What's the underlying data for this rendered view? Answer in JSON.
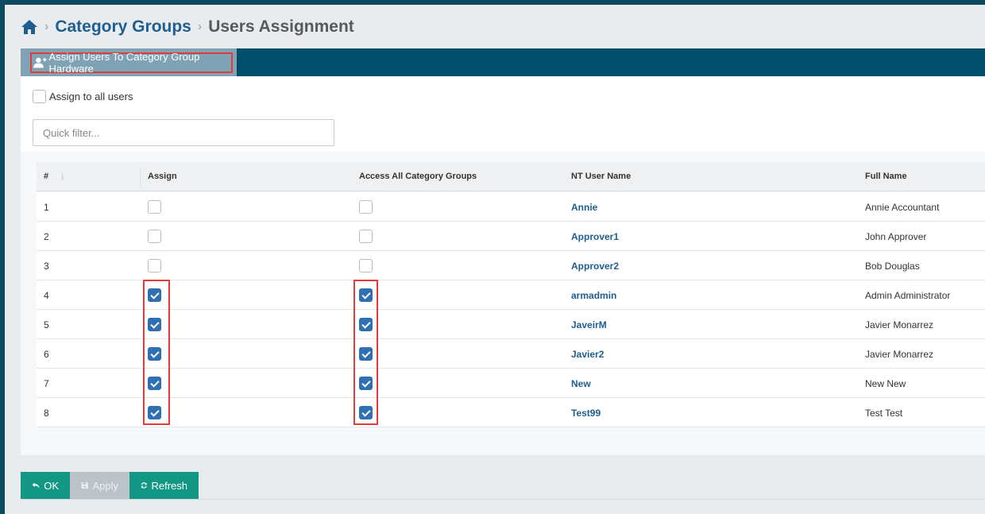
{
  "breadcrumb": {
    "home_icon": "home-icon",
    "parent": "Category Groups",
    "current": "Users Assignment"
  },
  "tab": {
    "label": "Assign Users To Category Group Hardware",
    "icon": "user-plus-icon"
  },
  "assign_all": {
    "label": "Assign to all users",
    "checked": false
  },
  "filter": {
    "placeholder": "Quick filter...",
    "value": ""
  },
  "grid": {
    "columns": [
      "#",
      "Assign",
      "Access All Category Groups",
      "NT User Name",
      "Full Name"
    ],
    "rows": [
      {
        "num": "1",
        "assign": false,
        "access_all": false,
        "user": "Annie",
        "full_name": "Annie Accountant"
      },
      {
        "num": "2",
        "assign": false,
        "access_all": false,
        "user": "Approver1",
        "full_name": "John Approver"
      },
      {
        "num": "3",
        "assign": false,
        "access_all": false,
        "user": "Approver2",
        "full_name": "Bob Douglas"
      },
      {
        "num": "4",
        "assign": true,
        "access_all": true,
        "user": "armadmin",
        "full_name": "Admin Administrator"
      },
      {
        "num": "5",
        "assign": true,
        "access_all": true,
        "user": "JaveirM",
        "full_name": "Javier Monarrez"
      },
      {
        "num": "6",
        "assign": true,
        "access_all": true,
        "user": "Javier2",
        "full_name": "Javier Monarrez"
      },
      {
        "num": "7",
        "assign": true,
        "access_all": true,
        "user": "New",
        "full_name": "New New"
      },
      {
        "num": "8",
        "assign": true,
        "access_all": true,
        "user": "Test99",
        "full_name": "Test Test"
      }
    ]
  },
  "footer": {
    "ok_label": "OK",
    "apply_label": "Apply",
    "refresh_label": "Refresh"
  },
  "colors": {
    "brand_dark": "#004e69",
    "accent_green": "#139785",
    "link_blue": "#1f5e8e",
    "checkbox_blue": "#2f6fb3",
    "highlight_red": "#e03c3c"
  }
}
